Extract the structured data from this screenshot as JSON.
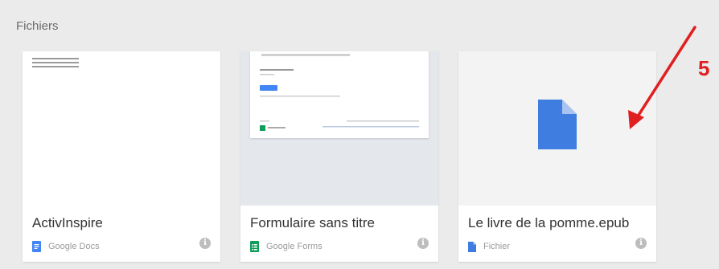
{
  "section": {
    "title": "Fichiers"
  },
  "files": [
    {
      "name": "ActivInspire",
      "type": "Google Docs",
      "icon": "google-docs-icon",
      "icon_color": "#4285f4"
    },
    {
      "name": "Formulaire sans titre",
      "type": "Google Forms",
      "icon": "google-forms-icon",
      "icon_color": "#0f9d58"
    },
    {
      "name": "Le livre de la pomme.epub",
      "type": "Fichier",
      "icon": "file-icon",
      "icon_color": "#3f7de0"
    }
  ],
  "annotation": {
    "number": "5",
    "color": "#e02020"
  }
}
